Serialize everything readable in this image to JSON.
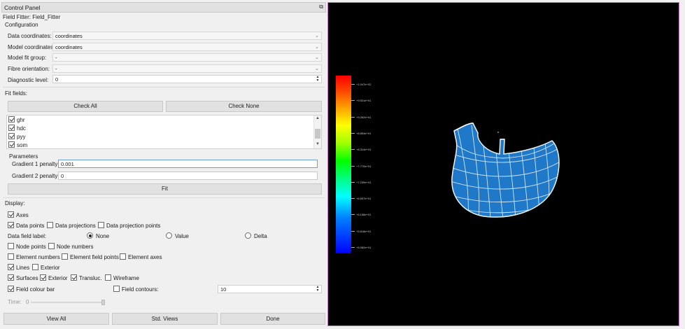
{
  "panel": {
    "title": "Control Panel",
    "undock_glyph": "⧉"
  },
  "field_fitter": {
    "label": "Field Fitter:",
    "value": "Field_Fitter"
  },
  "configuration": {
    "heading": "Configuration",
    "data_coordinates": {
      "label": "Data coordinates:",
      "value": "coordinates"
    },
    "model_coordinates": {
      "label": "Model coordinates:",
      "value": "coordinates"
    },
    "model_fit_group": {
      "label": "Model fit group:",
      "value": "-"
    },
    "fibre_orientation": {
      "label": "Fibre orientation:",
      "value": "-"
    },
    "diagnostic_level": {
      "label": "Diagnostic level:",
      "value": "0"
    }
  },
  "fit_fields": {
    "heading": "Fit fields:",
    "check_all": "Check All",
    "check_none": "Check None",
    "items": [
      {
        "label": "ghr",
        "checked": true
      },
      {
        "label": "hdc",
        "checked": true
      },
      {
        "label": "pyy",
        "checked": true
      },
      {
        "label": "som",
        "checked": true
      }
    ]
  },
  "parameters": {
    "heading": "Parameters",
    "gradient1": {
      "label": "Gradient 1 penalty:",
      "value": "0.001"
    },
    "gradient2": {
      "label": "Gradient 2 penalty:",
      "value": "0"
    },
    "fit_button": "Fit"
  },
  "display": {
    "heading": "Display:",
    "axes": "Axes",
    "data_points": "Data points",
    "data_projections": "Data projections",
    "data_projection_points": "Data projection points",
    "data_field_label": "Data field label:",
    "radio_none": "None",
    "radio_value": "Value",
    "radio_delta": "Delta",
    "node_points": "Node points",
    "node_numbers": "Node numbers",
    "element_numbers": "Element numbers",
    "element_field_points": "Element field points",
    "element_axes": "Element axes",
    "lines": "Lines",
    "lines_exterior": "Exterior",
    "surfaces": "Surfaces",
    "surfaces_exterior": "Exterior",
    "transluc": "Transluc.",
    "wireframe": "Wireframe",
    "field_colour_bar": "Field colour bar",
    "field_contours": "Field contours:",
    "contours_value": "10",
    "time_label": "Time:",
    "time_value": "0"
  },
  "bottom_buttons": {
    "view_all": "View All",
    "std_views": "Std. Views",
    "done": "Done"
  },
  "colorbar": {
    "labels": [
      "+1.047e+02",
      "+9.531e+01",
      "+9.262e+01",
      "+8.853e+01",
      "+8.314e+01",
      "+7.770e+01",
      "+7.239e+01",
      "+6.697e+01",
      "+6.158e+01",
      "+5.618e+01",
      "+5.082e+01"
    ]
  },
  "colors": {
    "mesh_fill": "#2a7fd0",
    "mesh_line": "#e8f2ff",
    "viewport_bg": "#000000",
    "viewport_border": "#d070d0"
  }
}
